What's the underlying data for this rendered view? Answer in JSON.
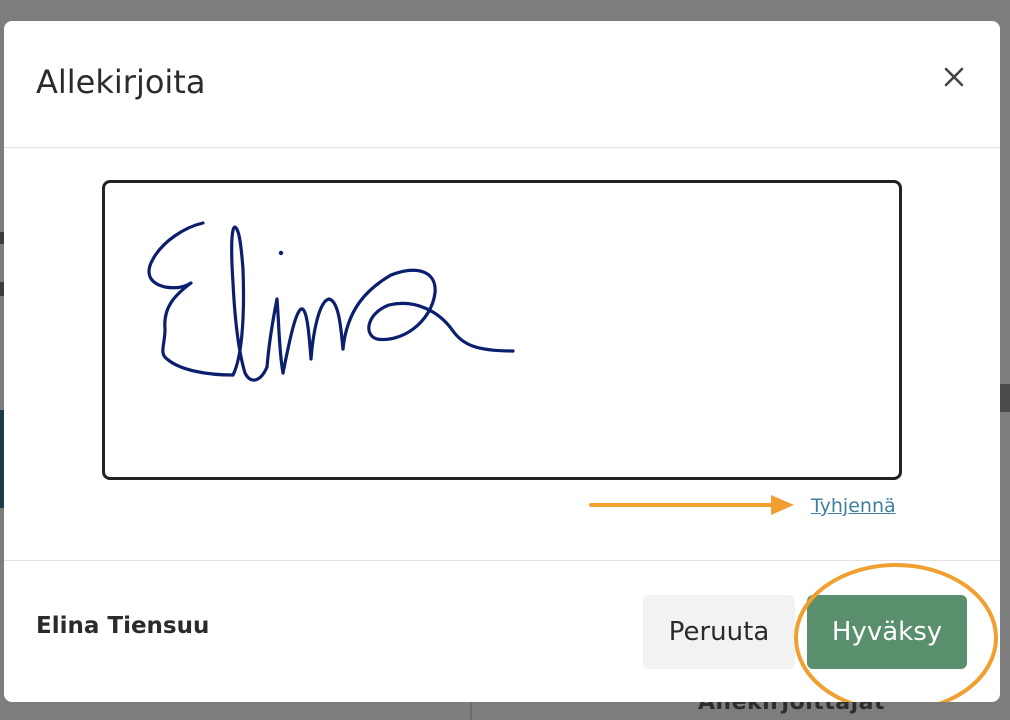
{
  "dialog": {
    "title": "Allekirjoita",
    "close_icon": "close-icon",
    "clear_label": "Tyhjennä",
    "signer_name": "Elina Tiensuu",
    "cancel_label": "Peruuta",
    "accept_label": "Hyväksy"
  },
  "background": {
    "partial_heading": "Allekirjoittajat"
  },
  "colors": {
    "accent": "#5a8f6e",
    "link": "#3f7fa0",
    "signature_ink": "#0b1f6e",
    "annotation": "#f0a030"
  }
}
